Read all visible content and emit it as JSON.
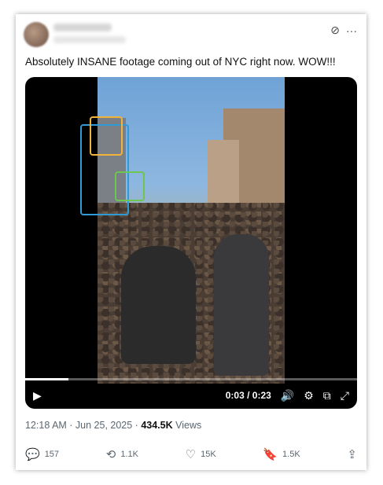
{
  "tweet": {
    "text": "Absolutely INSANE footage coming out of NYC right now. WOW!!!",
    "timestamp": "12:18 AM · Jun 25, 2025 ·",
    "views_count": "434.5K",
    "views_label": "Views"
  },
  "video": {
    "time_display": "0:03 / 0:23",
    "progress": 0.13
  },
  "actions": {
    "replies": "157",
    "reposts": "1.1K",
    "likes": "15K",
    "bookmarks": "1.5K"
  },
  "icons": {
    "grok": "grok-icon",
    "more": "more-icon",
    "play": "play-icon",
    "volume": "volume-icon",
    "settings": "gear-icon",
    "pip": "pip-icon",
    "fullscreen": "fullscreen-icon",
    "reply": "reply-icon",
    "repost": "repost-icon",
    "like": "heart-icon",
    "bookmark": "bookmark-icon",
    "share": "share-icon"
  },
  "colors": {
    "highlight_orange": "#f0b43c",
    "highlight_blue": "#2f9bd6",
    "highlight_green": "#6cc64f"
  }
}
